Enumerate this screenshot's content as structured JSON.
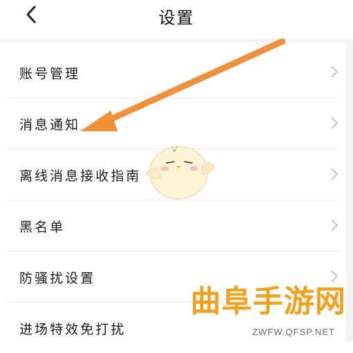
{
  "header": {
    "title": "设置",
    "back_icon": "chevron-left-icon"
  },
  "settings_items": [
    {
      "label": "账号管理",
      "icon": "chevron-right-icon"
    },
    {
      "label": "消息通知",
      "icon": "chevron-right-icon"
    },
    {
      "label": "离线消息接收指南",
      "icon": "chevron-right-icon"
    },
    {
      "label": "黑名单",
      "icon": "chevron-right-icon"
    },
    {
      "label": "防骚扰设置",
      "icon": "chevron-right-icon"
    },
    {
      "label": "进场特效免打扰",
      "icon": "chevron-right-icon"
    }
  ],
  "annotation": {
    "arrow_color": "#f0913a",
    "target": "消息通知"
  },
  "watermark": {
    "brand": "曲阜手游网",
    "url": "ZWFW.QFSP.NET",
    "color": "#f3a11c"
  },
  "mascot": {
    "icon": "chick-mascot-icon"
  }
}
